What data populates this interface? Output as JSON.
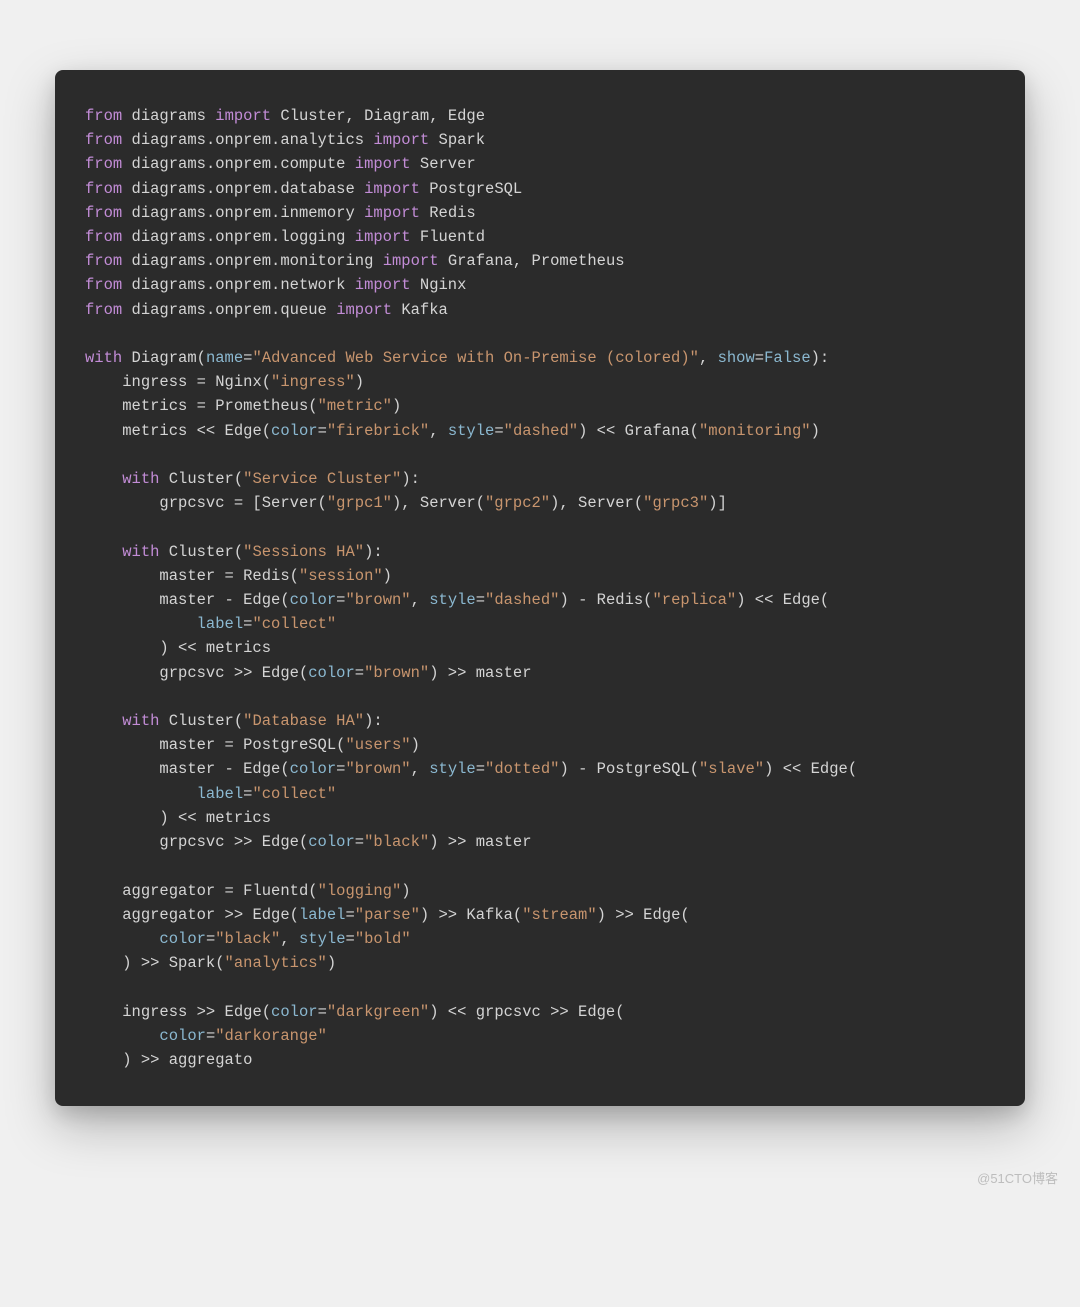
{
  "watermark": "@51CTO博客",
  "code": {
    "lines": [
      [
        [
          "kw",
          "from"
        ],
        [
          "p",
          " "
        ],
        [
          "mod",
          "diagrams"
        ],
        [
          "p",
          " "
        ],
        [
          "kw",
          "import"
        ],
        [
          "p",
          " "
        ],
        [
          "mod",
          "Cluster, Diagram, Edge"
        ]
      ],
      [
        [
          "kw",
          "from"
        ],
        [
          "p",
          " "
        ],
        [
          "mod",
          "diagrams.onprem.analytics"
        ],
        [
          "p",
          " "
        ],
        [
          "kw",
          "import"
        ],
        [
          "p",
          " "
        ],
        [
          "mod",
          "Spark"
        ]
      ],
      [
        [
          "kw",
          "from"
        ],
        [
          "p",
          " "
        ],
        [
          "mod",
          "diagrams.onprem.compute"
        ],
        [
          "p",
          " "
        ],
        [
          "kw",
          "import"
        ],
        [
          "p",
          " "
        ],
        [
          "mod",
          "Server"
        ]
      ],
      [
        [
          "kw",
          "from"
        ],
        [
          "p",
          " "
        ],
        [
          "mod",
          "diagrams.onprem.database"
        ],
        [
          "p",
          " "
        ],
        [
          "kw",
          "import"
        ],
        [
          "p",
          " "
        ],
        [
          "mod",
          "PostgreSQL"
        ]
      ],
      [
        [
          "kw",
          "from"
        ],
        [
          "p",
          " "
        ],
        [
          "mod",
          "diagrams.onprem.inmemory"
        ],
        [
          "p",
          " "
        ],
        [
          "kw",
          "import"
        ],
        [
          "p",
          " "
        ],
        [
          "mod",
          "Redis"
        ]
      ],
      [
        [
          "kw",
          "from"
        ],
        [
          "p",
          " "
        ],
        [
          "mod",
          "diagrams.onprem.logging"
        ],
        [
          "p",
          " "
        ],
        [
          "kw",
          "import"
        ],
        [
          "p",
          " "
        ],
        [
          "mod",
          "Fluentd"
        ]
      ],
      [
        [
          "kw",
          "from"
        ],
        [
          "p",
          " "
        ],
        [
          "mod",
          "diagrams.onprem.monitoring"
        ],
        [
          "p",
          " "
        ],
        [
          "kw",
          "import"
        ],
        [
          "p",
          " "
        ],
        [
          "mod",
          "Grafana, Prometheus"
        ]
      ],
      [
        [
          "kw",
          "from"
        ],
        [
          "p",
          " "
        ],
        [
          "mod",
          "diagrams.onprem.network"
        ],
        [
          "p",
          " "
        ],
        [
          "kw",
          "import"
        ],
        [
          "p",
          " "
        ],
        [
          "mod",
          "Nginx"
        ]
      ],
      [
        [
          "kw",
          "from"
        ],
        [
          "p",
          " "
        ],
        [
          "mod",
          "diagrams.onprem.queue"
        ],
        [
          "p",
          " "
        ],
        [
          "kw",
          "import"
        ],
        [
          "p",
          " "
        ],
        [
          "mod",
          "Kafka"
        ]
      ],
      [],
      [
        [
          "kw",
          "with"
        ],
        [
          "p",
          " "
        ],
        [
          "mod",
          "Diagram("
        ],
        [
          "param",
          "name"
        ],
        [
          "p",
          "="
        ],
        [
          "str",
          "\"Advanced Web Service with On-Premise (colored)\""
        ],
        [
          "p",
          ", "
        ],
        [
          "param",
          "show"
        ],
        [
          "p",
          "="
        ],
        [
          "bool",
          "False"
        ],
        [
          "p",
          "):"
        ]
      ],
      [
        [
          "p",
          "    "
        ],
        [
          "mod",
          "ingress = Nginx("
        ],
        [
          "str",
          "\"ingress\""
        ],
        [
          "p",
          ")"
        ]
      ],
      [
        [
          "p",
          "    "
        ],
        [
          "mod",
          "metrics = Prometheus("
        ],
        [
          "str",
          "\"metric\""
        ],
        [
          "p",
          ")"
        ]
      ],
      [
        [
          "p",
          "    "
        ],
        [
          "mod",
          "metrics << Edge("
        ],
        [
          "param",
          "color"
        ],
        [
          "p",
          "="
        ],
        [
          "str",
          "\"firebrick\""
        ],
        [
          "p",
          ", "
        ],
        [
          "param",
          "style"
        ],
        [
          "p",
          "="
        ],
        [
          "str",
          "\"dashed\""
        ],
        [
          "p",
          ") << Grafana("
        ],
        [
          "str",
          "\"monitoring\""
        ],
        [
          "p",
          ")"
        ]
      ],
      [],
      [
        [
          "p",
          "    "
        ],
        [
          "kw",
          "with"
        ],
        [
          "p",
          " "
        ],
        [
          "mod",
          "Cluster("
        ],
        [
          "str",
          "\"Service Cluster\""
        ],
        [
          "p",
          "):"
        ]
      ],
      [
        [
          "p",
          "        "
        ],
        [
          "mod",
          "grpcsvc = [Server("
        ],
        [
          "str",
          "\"grpc1\""
        ],
        [
          "p",
          "), Server("
        ],
        [
          "str",
          "\"grpc2\""
        ],
        [
          "p",
          "), Server("
        ],
        [
          "str",
          "\"grpc3\""
        ],
        [
          "p",
          ")]"
        ]
      ],
      [],
      [
        [
          "p",
          "    "
        ],
        [
          "kw",
          "with"
        ],
        [
          "p",
          " "
        ],
        [
          "mod",
          "Cluster("
        ],
        [
          "str",
          "\"Sessions HA\""
        ],
        [
          "p",
          "):"
        ]
      ],
      [
        [
          "p",
          "        "
        ],
        [
          "mod",
          "master = Redis("
        ],
        [
          "str",
          "\"session\""
        ],
        [
          "p",
          ")"
        ]
      ],
      [
        [
          "p",
          "        "
        ],
        [
          "mod",
          "master - Edge("
        ],
        [
          "param",
          "color"
        ],
        [
          "p",
          "="
        ],
        [
          "str",
          "\"brown\""
        ],
        [
          "p",
          ", "
        ],
        [
          "param",
          "style"
        ],
        [
          "p",
          "="
        ],
        [
          "str",
          "\"dashed\""
        ],
        [
          "p",
          ") - Redis("
        ],
        [
          "str",
          "\"replica\""
        ],
        [
          "p",
          ") << Edge("
        ]
      ],
      [
        [
          "p",
          "            "
        ],
        [
          "param",
          "label"
        ],
        [
          "p",
          "="
        ],
        [
          "str",
          "\"collect\""
        ]
      ],
      [
        [
          "p",
          "        "
        ],
        [
          "mod",
          ") << metrics"
        ]
      ],
      [
        [
          "p",
          "        "
        ],
        [
          "mod",
          "grpcsvc >> Edge("
        ],
        [
          "param",
          "color"
        ],
        [
          "p",
          "="
        ],
        [
          "str",
          "\"brown\""
        ],
        [
          "p",
          ") >> master"
        ]
      ],
      [],
      [
        [
          "p",
          "    "
        ],
        [
          "kw",
          "with"
        ],
        [
          "p",
          " "
        ],
        [
          "mod",
          "Cluster("
        ],
        [
          "str",
          "\"Database HA\""
        ],
        [
          "p",
          "):"
        ]
      ],
      [
        [
          "p",
          "        "
        ],
        [
          "mod",
          "master = PostgreSQL("
        ],
        [
          "str",
          "\"users\""
        ],
        [
          "p",
          ")"
        ]
      ],
      [
        [
          "p",
          "        "
        ],
        [
          "mod",
          "master - Edge("
        ],
        [
          "param",
          "color"
        ],
        [
          "p",
          "="
        ],
        [
          "str",
          "\"brown\""
        ],
        [
          "p",
          ", "
        ],
        [
          "param",
          "style"
        ],
        [
          "p",
          "="
        ],
        [
          "str",
          "\"dotted\""
        ],
        [
          "p",
          ") - PostgreSQL("
        ],
        [
          "str",
          "\"slave\""
        ],
        [
          "p",
          ") << Edge("
        ]
      ],
      [
        [
          "p",
          "            "
        ],
        [
          "param",
          "label"
        ],
        [
          "p",
          "="
        ],
        [
          "str",
          "\"collect\""
        ]
      ],
      [
        [
          "p",
          "        "
        ],
        [
          "mod",
          ") << metrics"
        ]
      ],
      [
        [
          "p",
          "        "
        ],
        [
          "mod",
          "grpcsvc >> Edge("
        ],
        [
          "param",
          "color"
        ],
        [
          "p",
          "="
        ],
        [
          "str",
          "\"black\""
        ],
        [
          "p",
          ") >> master"
        ]
      ],
      [],
      [
        [
          "p",
          "    "
        ],
        [
          "mod",
          "aggregator = Fluentd("
        ],
        [
          "str",
          "\"logging\""
        ],
        [
          "p",
          ")"
        ]
      ],
      [
        [
          "p",
          "    "
        ],
        [
          "mod",
          "aggregator >> Edge("
        ],
        [
          "param",
          "label"
        ],
        [
          "p",
          "="
        ],
        [
          "str",
          "\"parse\""
        ],
        [
          "p",
          ") >> Kafka("
        ],
        [
          "str",
          "\"stream\""
        ],
        [
          "p",
          ") >> Edge("
        ]
      ],
      [
        [
          "p",
          "        "
        ],
        [
          "param",
          "color"
        ],
        [
          "p",
          "="
        ],
        [
          "str",
          "\"black\""
        ],
        [
          "p",
          ", "
        ],
        [
          "param",
          "style"
        ],
        [
          "p",
          "="
        ],
        [
          "str",
          "\"bold\""
        ]
      ],
      [
        [
          "p",
          "    "
        ],
        [
          "mod",
          ") >> Spark("
        ],
        [
          "str",
          "\"analytics\""
        ],
        [
          "p",
          ")"
        ]
      ],
      [],
      [
        [
          "p",
          "    "
        ],
        [
          "mod",
          "ingress >> Edge("
        ],
        [
          "param",
          "color"
        ],
        [
          "p",
          "="
        ],
        [
          "str",
          "\"darkgreen\""
        ],
        [
          "p",
          ") << grpcsvc >> Edge("
        ]
      ],
      [
        [
          "p",
          "        "
        ],
        [
          "param",
          "color"
        ],
        [
          "p",
          "="
        ],
        [
          "str",
          "\"darkorange\""
        ]
      ],
      [
        [
          "p",
          "    "
        ],
        [
          "mod",
          ") >> aggregato"
        ]
      ]
    ]
  }
}
